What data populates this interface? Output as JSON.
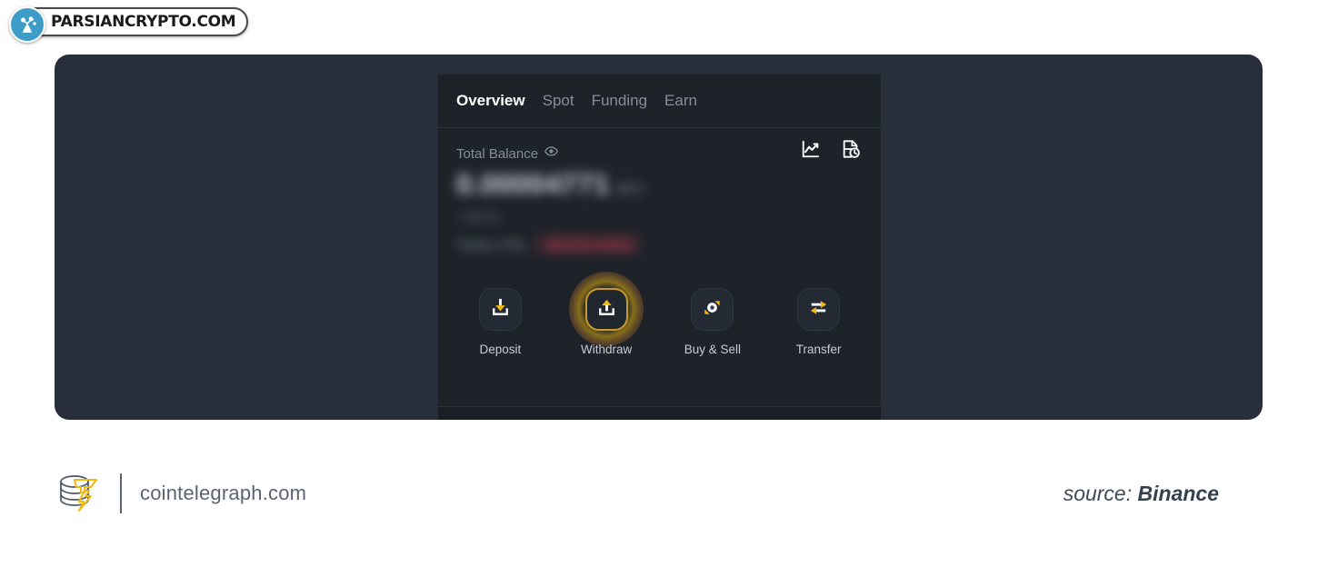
{
  "watermark": {
    "text": "PARSIANCRYPTO.COM",
    "logo_icon": "person-fountain-icon",
    "accent_color": "#3d9cc8"
  },
  "card": {
    "tabs": [
      {
        "label": "Overview",
        "active": true
      },
      {
        "label": "Spot",
        "active": false
      },
      {
        "label": "Funding",
        "active": false
      },
      {
        "label": "Earn",
        "active": false
      }
    ],
    "balance": {
      "label": "Total Balance",
      "eye_icon": "eye-visible-icon",
      "amount": "0.00004771",
      "unit": "BTC",
      "sub_value": "≈ $4.53",
      "pnl_label": "Today's PNL",
      "pnl_value": "-$0.02(-0.44%)",
      "pnl_color": "#f6465d",
      "blurred": true
    },
    "head_icons": [
      {
        "name": "analytics-chart-icon"
      },
      {
        "name": "transaction-history-icon"
      }
    ],
    "actions": [
      {
        "label": "Deposit",
        "icon": "deposit-arrow-down-icon",
        "highlighted": false
      },
      {
        "label": "Withdraw",
        "icon": "withdraw-arrow-up-icon",
        "highlighted": true
      },
      {
        "label": "Buy & Sell",
        "icon": "buy-sell-convert-icon",
        "highlighted": false
      },
      {
        "label": "Transfer",
        "icon": "transfer-arrows-icon",
        "highlighted": false
      }
    ],
    "accent_color": "#f0b90b",
    "background_color": "#1e2329"
  },
  "panel": {
    "background_color": "#282e3a"
  },
  "footer": {
    "logo_icon": "cointelegraph-coins-bolt-icon",
    "url": "cointelegraph.com",
    "source_prefix": "source:",
    "source_name": "Binance"
  }
}
